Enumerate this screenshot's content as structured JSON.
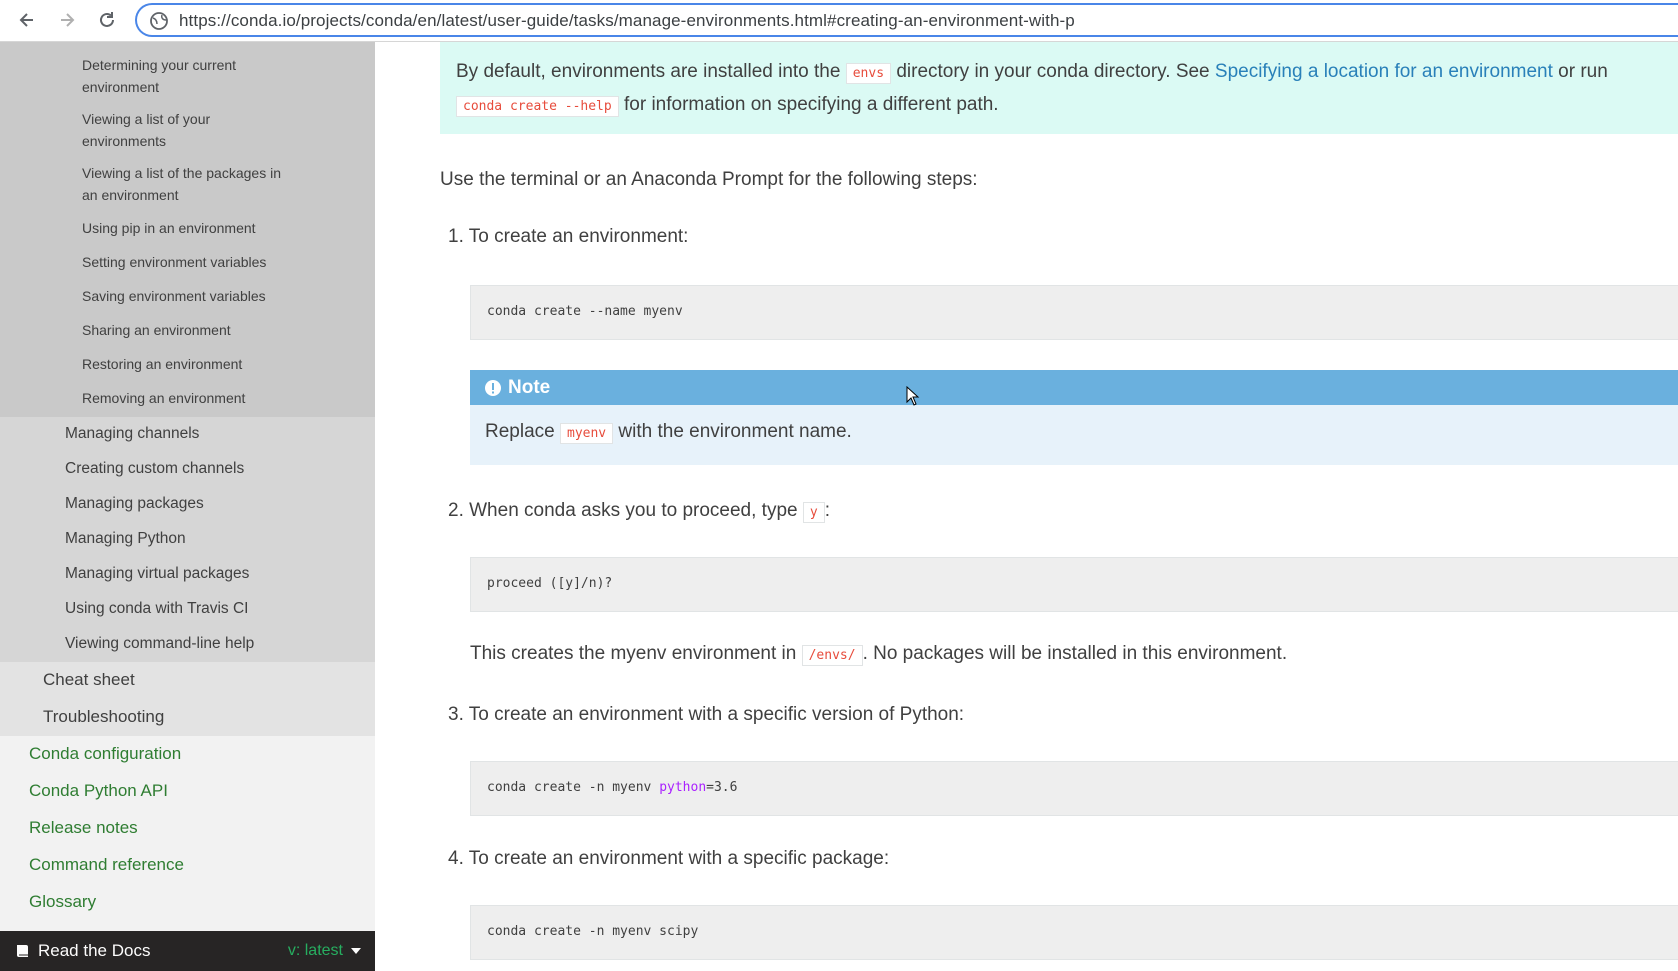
{
  "browser": {
    "url": "https://conda.io/projects/conda/en/latest/user-guide/tasks/manage-environments.html#creating-an-environment-with-p"
  },
  "sidebar": {
    "level3": [
      "Determining your current environment",
      "Viewing a list of your environments",
      "Viewing a list of the packages in an environment",
      "Using pip in an environment",
      "Setting environment variables",
      "Saving environment variables",
      "Sharing an environment",
      "Restoring an environment",
      "Removing an environment"
    ],
    "level2": [
      "Managing channels",
      "Creating custom channels",
      "Managing packages",
      "Managing Python",
      "Managing virtual packages",
      "Using conda with Travis CI",
      "Viewing command-line help"
    ],
    "level1": [
      "Cheat sheet",
      "Troubleshooting"
    ],
    "top": [
      "Conda configuration",
      "Conda Python API",
      "Release notes",
      "Command reference",
      "Glossary"
    ],
    "rtd": {
      "label": "Read the Docs",
      "version": "v: latest"
    }
  },
  "content": {
    "intro": {
      "t1": "By default, environments are installed into the ",
      "code1": "envs",
      "t2": " directory in your conda directory. See ",
      "link": "Specifying a location for an environment",
      "t3": " or run",
      "code2": "conda create --help",
      "t4": " for information on specifying a different path."
    },
    "use_terminal": "Use the terminal or an Anaconda Prompt for the following steps:",
    "step1": "1. To create an environment:",
    "code1": "conda create --name myenv",
    "note": {
      "title": "Note",
      "t1": "Replace ",
      "code": "myenv",
      "t2": " with the environment name."
    },
    "step2": {
      "text": "2. When conda asks you to proceed, type ",
      "code": "y",
      "suffix": ":"
    },
    "code2": "proceed ([y]/n)?",
    "creates": {
      "t1": "This creates the myenv environment in ",
      "code": "/envs/",
      "t2": ". No packages will be installed in this environment."
    },
    "step3": "3. To create an environment with a specific version of Python:",
    "code3": {
      "prefix": "conda create -n myenv ",
      "kw": "python",
      "suffix": "=3.6"
    },
    "step4": "4. To create an environment with a specific package:",
    "code4": "conda create -n myenv scipy"
  }
}
